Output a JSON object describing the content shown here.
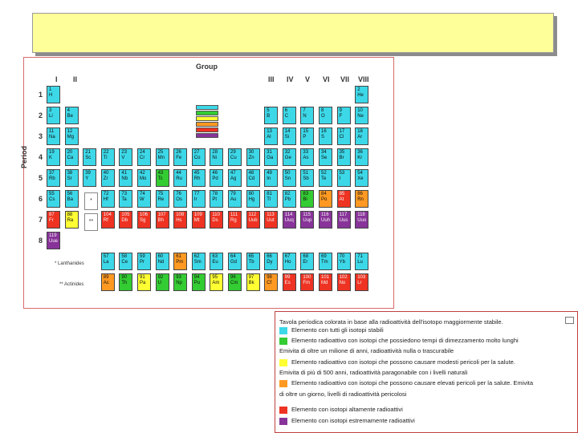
{
  "periodic_table": {
    "group_title": "Group",
    "period_title": "Period",
    "groups": [
      "I",
      "II",
      "III",
      "IV",
      "V",
      "VI",
      "VII",
      "VIII"
    ],
    "periods": [
      "1",
      "2",
      "3",
      "4",
      "5",
      "6",
      "7",
      "8"
    ],
    "lanthanides_label": "* Lanthanides",
    "actinides_label": "** Actinides",
    "lanthanide_marker": "*",
    "actinide_marker": "**",
    "category_colors": {
      "stable": "#3cd8e8",
      "long": "#33cc33",
      "low": "#ffff33",
      "natural": "#ff9922",
      "danger": "#ee3322",
      "extreme": "#883399"
    },
    "elements": [
      {
        "n": "1",
        "s": "H",
        "c": "stable",
        "r": 1,
        "col": 1
      },
      {
        "n": "2",
        "s": "He",
        "c": "stable",
        "r": 1,
        "col": 18
      },
      {
        "n": "3",
        "s": "Li",
        "c": "stable",
        "r": 2,
        "col": 1
      },
      {
        "n": "4",
        "s": "Be",
        "c": "stable",
        "r": 2,
        "col": 2
      },
      {
        "n": "5",
        "s": "B",
        "c": "stable",
        "r": 2,
        "col": 13
      },
      {
        "n": "6",
        "s": "C",
        "c": "stable",
        "r": 2,
        "col": 14
      },
      {
        "n": "7",
        "s": "N",
        "c": "stable",
        "r": 2,
        "col": 15
      },
      {
        "n": "8",
        "s": "O",
        "c": "stable",
        "r": 2,
        "col": 16
      },
      {
        "n": "9",
        "s": "F",
        "c": "stable",
        "r": 2,
        "col": 17
      },
      {
        "n": "10",
        "s": "Ne",
        "c": "stable",
        "r": 2,
        "col": 18
      },
      {
        "n": "11",
        "s": "Na",
        "c": "stable",
        "r": 3,
        "col": 1
      },
      {
        "n": "12",
        "s": "Mg",
        "c": "stable",
        "r": 3,
        "col": 2
      },
      {
        "n": "13",
        "s": "Al",
        "c": "stable",
        "r": 3,
        "col": 13
      },
      {
        "n": "14",
        "s": "Si",
        "c": "stable",
        "r": 3,
        "col": 14
      },
      {
        "n": "15",
        "s": "P",
        "c": "stable",
        "r": 3,
        "col": 15
      },
      {
        "n": "16",
        "s": "S",
        "c": "stable",
        "r": 3,
        "col": 16
      },
      {
        "n": "17",
        "s": "Cl",
        "c": "stable",
        "r": 3,
        "col": 17
      },
      {
        "n": "18",
        "s": "Ar",
        "c": "stable",
        "r": 3,
        "col": 18
      },
      {
        "n": "19",
        "s": "K",
        "c": "stable",
        "r": 4,
        "col": 1
      },
      {
        "n": "20",
        "s": "Ca",
        "c": "stable",
        "r": 4,
        "col": 2
      },
      {
        "n": "21",
        "s": "Sc",
        "c": "stable",
        "r": 4,
        "col": 3
      },
      {
        "n": "22",
        "s": "Ti",
        "c": "stable",
        "r": 4,
        "col": 4
      },
      {
        "n": "23",
        "s": "V",
        "c": "stable",
        "r": 4,
        "col": 5
      },
      {
        "n": "24",
        "s": "Cr",
        "c": "stable",
        "r": 4,
        "col": 6
      },
      {
        "n": "25",
        "s": "Mn",
        "c": "stable",
        "r": 4,
        "col": 7
      },
      {
        "n": "26",
        "s": "Fe",
        "c": "stable",
        "r": 4,
        "col": 8
      },
      {
        "n": "27",
        "s": "Co",
        "c": "stable",
        "r": 4,
        "col": 9
      },
      {
        "n": "28",
        "s": "Ni",
        "c": "stable",
        "r": 4,
        "col": 10
      },
      {
        "n": "29",
        "s": "Cu",
        "c": "stable",
        "r": 4,
        "col": 11
      },
      {
        "n": "30",
        "s": "Zn",
        "c": "stable",
        "r": 4,
        "col": 12
      },
      {
        "n": "31",
        "s": "Ga",
        "c": "stable",
        "r": 4,
        "col": 13
      },
      {
        "n": "32",
        "s": "Ge",
        "c": "stable",
        "r": 4,
        "col": 14
      },
      {
        "n": "33",
        "s": "As",
        "c": "stable",
        "r": 4,
        "col": 15
      },
      {
        "n": "34",
        "s": "Se",
        "c": "stable",
        "r": 4,
        "col": 16
      },
      {
        "n": "35",
        "s": "Br",
        "c": "stable",
        "r": 4,
        "col": 17
      },
      {
        "n": "36",
        "s": "Kr",
        "c": "stable",
        "r": 4,
        "col": 18
      },
      {
        "n": "37",
        "s": "Rb",
        "c": "stable",
        "r": 5,
        "col": 1
      },
      {
        "n": "38",
        "s": "Sr",
        "c": "stable",
        "r": 5,
        "col": 2
      },
      {
        "n": "39",
        "s": "Y",
        "c": "stable",
        "r": 5,
        "col": 3
      },
      {
        "n": "40",
        "s": "Zr",
        "c": "stable",
        "r": 5,
        "col": 4
      },
      {
        "n": "41",
        "s": "Nb",
        "c": "stable",
        "r": 5,
        "col": 5
      },
      {
        "n": "42",
        "s": "Mo",
        "c": "stable",
        "r": 5,
        "col": 6
      },
      {
        "n": "43",
        "s": "Tc",
        "c": "long",
        "r": 5,
        "col": 7
      },
      {
        "n": "44",
        "s": "Ru",
        "c": "stable",
        "r": 5,
        "col": 8
      },
      {
        "n": "45",
        "s": "Rh",
        "c": "stable",
        "r": 5,
        "col": 9
      },
      {
        "n": "46",
        "s": "Pd",
        "c": "stable",
        "r": 5,
        "col": 10
      },
      {
        "n": "47",
        "s": "Ag",
        "c": "stable",
        "r": 5,
        "col": 11
      },
      {
        "n": "48",
        "s": "Cd",
        "c": "stable",
        "r": 5,
        "col": 12
      },
      {
        "n": "49",
        "s": "In",
        "c": "stable",
        "r": 5,
        "col": 13
      },
      {
        "n": "50",
        "s": "Sn",
        "c": "stable",
        "r": 5,
        "col": 14
      },
      {
        "n": "51",
        "s": "Sb",
        "c": "stable",
        "r": 5,
        "col": 15
      },
      {
        "n": "52",
        "s": "Te",
        "c": "stable",
        "r": 5,
        "col": 16
      },
      {
        "n": "53",
        "s": "I",
        "c": "stable",
        "r": 5,
        "col": 17
      },
      {
        "n": "54",
        "s": "Xe",
        "c": "stable",
        "r": 5,
        "col": 18
      },
      {
        "n": "55",
        "s": "Cs",
        "c": "stable",
        "r": 6,
        "col": 1
      },
      {
        "n": "56",
        "s": "Ba",
        "c": "stable",
        "r": 6,
        "col": 2
      },
      {
        "n": "72",
        "s": "Hf",
        "c": "stable",
        "r": 6,
        "col": 4
      },
      {
        "n": "73",
        "s": "Ta",
        "c": "stable",
        "r": 6,
        "col": 5
      },
      {
        "n": "74",
        "s": "W",
        "c": "stable",
        "r": 6,
        "col": 6
      },
      {
        "n": "75",
        "s": "Re",
        "c": "stable",
        "r": 6,
        "col": 7
      },
      {
        "n": "76",
        "s": "Os",
        "c": "stable",
        "r": 6,
        "col": 8
      },
      {
        "n": "77",
        "s": "Ir",
        "c": "stable",
        "r": 6,
        "col": 9
      },
      {
        "n": "78",
        "s": "Pt",
        "c": "stable",
        "r": 6,
        "col": 10
      },
      {
        "n": "79",
        "s": "Au",
        "c": "stable",
        "r": 6,
        "col": 11
      },
      {
        "n": "80",
        "s": "Hg",
        "c": "stable",
        "r": 6,
        "col": 12
      },
      {
        "n": "81",
        "s": "Tl",
        "c": "stable",
        "r": 6,
        "col": 13
      },
      {
        "n": "82",
        "s": "Pb",
        "c": "stable",
        "r": 6,
        "col": 14
      },
      {
        "n": "83",
        "s": "Bi",
        "c": "long",
        "r": 6,
        "col": 15
      },
      {
        "n": "84",
        "s": "Po",
        "c": "natural",
        "r": 6,
        "col": 16
      },
      {
        "n": "85",
        "s": "At",
        "c": "danger",
        "r": 6,
        "col": 17
      },
      {
        "n": "86",
        "s": "Rn",
        "c": "natural",
        "r": 6,
        "col": 18
      },
      {
        "n": "87",
        "s": "Fr",
        "c": "danger",
        "r": 7,
        "col": 1
      },
      {
        "n": "88",
        "s": "Ra",
        "c": "low",
        "r": 7,
        "col": 2
      },
      {
        "n": "104",
        "s": "Rf",
        "c": "danger",
        "r": 7,
        "col": 4
      },
      {
        "n": "105",
        "s": "Db",
        "c": "danger",
        "r": 7,
        "col": 5
      },
      {
        "n": "106",
        "s": "Sg",
        "c": "danger",
        "r": 7,
        "col": 6
      },
      {
        "n": "107",
        "s": "Bh",
        "c": "danger",
        "r": 7,
        "col": 7
      },
      {
        "n": "108",
        "s": "Hs",
        "c": "danger",
        "r": 7,
        "col": 8
      },
      {
        "n": "109",
        "s": "Mt",
        "c": "danger",
        "r": 7,
        "col": 9
      },
      {
        "n": "110",
        "s": "Ds",
        "c": "danger",
        "r": 7,
        "col": 10
      },
      {
        "n": "111",
        "s": "Rg",
        "c": "danger",
        "r": 7,
        "col": 11
      },
      {
        "n": "112",
        "s": "Uub",
        "c": "danger",
        "r": 7,
        "col": 12
      },
      {
        "n": "113",
        "s": "Uut",
        "c": "danger",
        "r": 7,
        "col": 13
      },
      {
        "n": "114",
        "s": "Uuq",
        "c": "extreme",
        "r": 7,
        "col": 14
      },
      {
        "n": "115",
        "s": "Uup",
        "c": "extreme",
        "r": 7,
        "col": 15
      },
      {
        "n": "116",
        "s": "Uuh",
        "c": "extreme",
        "r": 7,
        "col": 16
      },
      {
        "n": "117",
        "s": "Uus",
        "c": "extreme",
        "r": 7,
        "col": 17
      },
      {
        "n": "118",
        "s": "Uuo",
        "c": "extreme",
        "r": 7,
        "col": 18
      },
      {
        "n": "119",
        "s": "Uue",
        "c": "extreme",
        "r": 8,
        "col": 1
      },
      {
        "n": "57",
        "s": "La",
        "c": "stable",
        "r": 9,
        "col": 4
      },
      {
        "n": "58",
        "s": "Ce",
        "c": "stable",
        "r": 9,
        "col": 5
      },
      {
        "n": "59",
        "s": "Pr",
        "c": "stable",
        "r": 9,
        "col": 6
      },
      {
        "n": "60",
        "s": "Nd",
        "c": "stable",
        "r": 9,
        "col": 7
      },
      {
        "n": "61",
        "s": "Pm",
        "c": "natural",
        "r": 9,
        "col": 8
      },
      {
        "n": "62",
        "s": "Sm",
        "c": "stable",
        "r": 9,
        "col": 9
      },
      {
        "n": "63",
        "s": "Eu",
        "c": "stable",
        "r": 9,
        "col": 10
      },
      {
        "n": "64",
        "s": "Gd",
        "c": "stable",
        "r": 9,
        "col": 11
      },
      {
        "n": "65",
        "s": "Tb",
        "c": "stable",
        "r": 9,
        "col": 12
      },
      {
        "n": "66",
        "s": "Dy",
        "c": "stable",
        "r": 9,
        "col": 13
      },
      {
        "n": "67",
        "s": "Ho",
        "c": "stable",
        "r": 9,
        "col": 14
      },
      {
        "n": "68",
        "s": "Er",
        "c": "stable",
        "r": 9,
        "col": 15
      },
      {
        "n": "69",
        "s": "Tm",
        "c": "stable",
        "r": 9,
        "col": 16
      },
      {
        "n": "70",
        "s": "Yb",
        "c": "stable",
        "r": 9,
        "col": 17
      },
      {
        "n": "71",
        "s": "Lu",
        "c": "stable",
        "r": 9,
        "col": 18
      },
      {
        "n": "89",
        "s": "Ac",
        "c": "natural",
        "r": 10,
        "col": 4
      },
      {
        "n": "90",
        "s": "Th",
        "c": "long",
        "r": 10,
        "col": 5
      },
      {
        "n": "91",
        "s": "Pa",
        "c": "low",
        "r": 10,
        "col": 6
      },
      {
        "n": "92",
        "s": "U",
        "c": "long",
        "r": 10,
        "col": 7
      },
      {
        "n": "93",
        "s": "Np",
        "c": "long",
        "r": 10,
        "col": 8
      },
      {
        "n": "94",
        "s": "Pu",
        "c": "long",
        "r": 10,
        "col": 9
      },
      {
        "n": "95",
        "s": "Am",
        "c": "low",
        "r": 10,
        "col": 10
      },
      {
        "n": "96",
        "s": "Cm",
        "c": "long",
        "r": 10,
        "col": 11
      },
      {
        "n": "97",
        "s": "Bk",
        "c": "low",
        "r": 10,
        "col": 12
      },
      {
        "n": "98",
        "s": "Cf",
        "c": "natural",
        "r": 10,
        "col": 13
      },
      {
        "n": "99",
        "s": "Es",
        "c": "danger",
        "r": 10,
        "col": 14
      },
      {
        "n": "100",
        "s": "Fm",
        "c": "danger",
        "r": 10,
        "col": 15
      },
      {
        "n": "101",
        "s": "Md",
        "c": "danger",
        "r": 10,
        "col": 16
      },
      {
        "n": "102",
        "s": "No",
        "c": "danger",
        "r": 10,
        "col": 17
      },
      {
        "n": "103",
        "s": "Lr",
        "c": "danger",
        "r": 10,
        "col": 18
      }
    ]
  },
  "legend": {
    "title": "Tavola periodica colorata in base alla radioattività dell'isotopo maggiormente stabile.",
    "items": [
      {
        "color": "#3cd8e8",
        "text": "Elemento con tutti gli isotopi stabili"
      },
      {
        "color": "#33cc33",
        "text": "Elemento radioattivo con isotopi che possiedono tempi di dimezzamento molto lunghi"
      },
      {
        "color": "",
        "text": "Emivita di oltre un milione di anni, radioattività nulla o trascurabile"
      },
      {
        "color": "#ffff33",
        "text": "Elemento radioattivo con isotopi che possono causare modesti pericoli per la salute."
      },
      {
        "color": "",
        "text": "Emivita di più di 500 anni, radioattività paragonabile con i livelli naturali"
      },
      {
        "color": "#ff9922",
        "text": "Elemento radioattivo con isotopi che possono causare elevati pericoli per la salute. Emivita"
      },
      {
        "color": "",
        "text": "di oltre un giorno, livelli di radioattività pericolosi"
      },
      {
        "color": "#ee3322",
        "text": "Elemento con isotopi altamente radioattivi"
      },
      {
        "color": "#883399",
        "text": "Elemento con isotopi estremamente radioattivi"
      }
    ]
  }
}
